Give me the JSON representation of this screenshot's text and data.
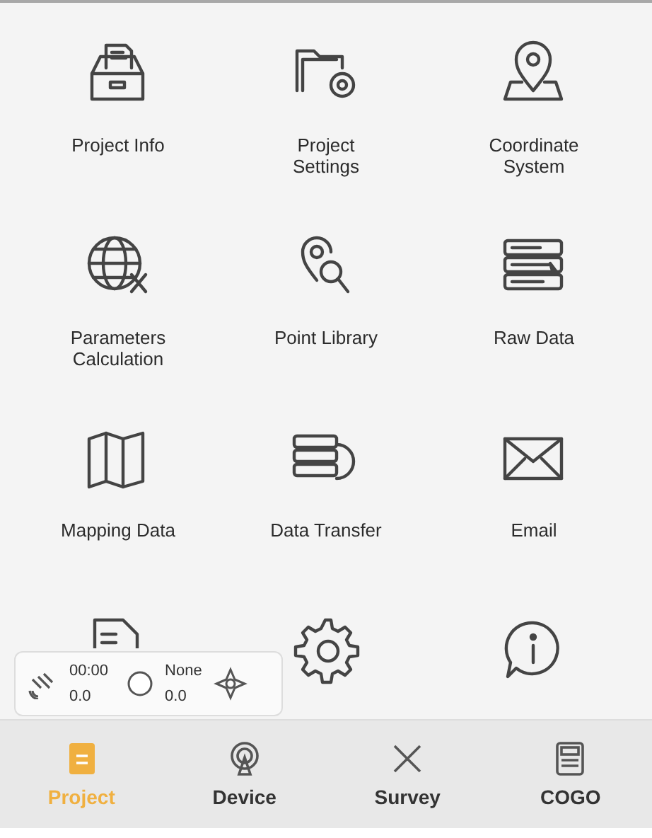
{
  "tiles": [
    {
      "label": "Project Info"
    },
    {
      "label": "Project Settings"
    },
    {
      "label": "Coordinate System"
    },
    {
      "label": "Parameters Calculation"
    },
    {
      "label": "Point Library"
    },
    {
      "label": "Raw Data"
    },
    {
      "label": "Mapping Data"
    },
    {
      "label": "Data Transfer"
    },
    {
      "label": "Email"
    }
  ],
  "status_widget": {
    "time": "00:00",
    "value_1": "0.0",
    "solution": "None",
    "value_2": "0.0"
  },
  "nav": [
    {
      "label": "Project",
      "selected": true
    },
    {
      "label": "Device",
      "selected": false
    },
    {
      "label": "Survey",
      "selected": false
    },
    {
      "label": "COGO",
      "selected": false
    }
  ]
}
